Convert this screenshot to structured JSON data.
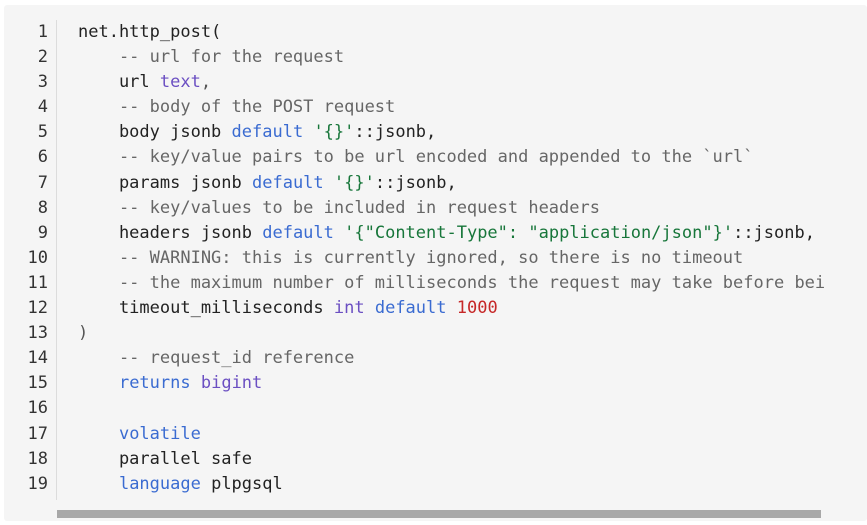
{
  "colors": {
    "background": "#f5f5f5",
    "comment": "#666666",
    "keyword": "#3a6bd1",
    "type": "#6b4fc2",
    "string": "#17763a",
    "number": "#c62828"
  },
  "lines": [
    {
      "num": "1",
      "tokens": [
        {
          "t": "net.http_post(",
          "c": "plain"
        }
      ]
    },
    {
      "num": "2",
      "tokens": [
        {
          "t": "    -- url for the request",
          "c": "comment"
        }
      ]
    },
    {
      "num": "3",
      "tokens": [
        {
          "t": "    url ",
          "c": "plain"
        },
        {
          "t": "text",
          "c": "type"
        },
        {
          "t": ",",
          "c": "punct"
        }
      ]
    },
    {
      "num": "4",
      "tokens": [
        {
          "t": "    -- body of the POST request",
          "c": "comment"
        }
      ]
    },
    {
      "num": "5",
      "tokens": [
        {
          "t": "    body jsonb ",
          "c": "plain"
        },
        {
          "t": "default",
          "c": "keyword"
        },
        {
          "t": " ",
          "c": "plain"
        },
        {
          "t": "'{}'",
          "c": "string"
        },
        {
          "t": "::jsonb,",
          "c": "plain"
        }
      ]
    },
    {
      "num": "6",
      "tokens": [
        {
          "t": "    -- key/value pairs to be url encoded and appended to the `url`",
          "c": "comment"
        }
      ]
    },
    {
      "num": "7",
      "tokens": [
        {
          "t": "    params jsonb ",
          "c": "plain"
        },
        {
          "t": "default",
          "c": "keyword"
        },
        {
          "t": " ",
          "c": "plain"
        },
        {
          "t": "'{}'",
          "c": "string"
        },
        {
          "t": "::jsonb,",
          "c": "plain"
        }
      ]
    },
    {
      "num": "8",
      "tokens": [
        {
          "t": "    -- key/values to be included in request headers",
          "c": "comment"
        }
      ]
    },
    {
      "num": "9",
      "tokens": [
        {
          "t": "    headers jsonb ",
          "c": "plain"
        },
        {
          "t": "default",
          "c": "keyword"
        },
        {
          "t": " ",
          "c": "plain"
        },
        {
          "t": "'{\"Content-Type\": \"application/json\"}'",
          "c": "string"
        },
        {
          "t": "::jsonb,",
          "c": "plain"
        }
      ]
    },
    {
      "num": "10",
      "tokens": [
        {
          "t": "    -- WARNING: this is currently ignored, so there is no timeout",
          "c": "comment"
        }
      ]
    },
    {
      "num": "11",
      "tokens": [
        {
          "t": "    -- the maximum number of milliseconds the request may take before bei",
          "c": "comment"
        }
      ]
    },
    {
      "num": "12",
      "tokens": [
        {
          "t": "    timeout_milliseconds ",
          "c": "plain"
        },
        {
          "t": "int",
          "c": "type"
        },
        {
          "t": " ",
          "c": "plain"
        },
        {
          "t": "default",
          "c": "keyword"
        },
        {
          "t": " ",
          "c": "plain"
        },
        {
          "t": "1000",
          "c": "number"
        }
      ]
    },
    {
      "num": "13",
      "tokens": [
        {
          "t": ")",
          "c": "punct"
        }
      ]
    },
    {
      "num": "14",
      "tokens": [
        {
          "t": "    -- request_id reference",
          "c": "comment"
        }
      ]
    },
    {
      "num": "15",
      "tokens": [
        {
          "t": "    ",
          "c": "plain"
        },
        {
          "t": "returns",
          "c": "keyword"
        },
        {
          "t": " ",
          "c": "plain"
        },
        {
          "t": "bigint",
          "c": "type"
        }
      ]
    },
    {
      "num": "16",
      "tokens": [
        {
          "t": "",
          "c": "plain"
        }
      ]
    },
    {
      "num": "17",
      "tokens": [
        {
          "t": "    ",
          "c": "plain"
        },
        {
          "t": "volatile",
          "c": "keyword"
        }
      ]
    },
    {
      "num": "18",
      "tokens": [
        {
          "t": "    parallel safe",
          "c": "plain"
        }
      ]
    },
    {
      "num": "19",
      "tokens": [
        {
          "t": "    ",
          "c": "plain"
        },
        {
          "t": "language",
          "c": "keyword"
        },
        {
          "t": " plpgsql",
          "c": "plain"
        }
      ]
    }
  ]
}
